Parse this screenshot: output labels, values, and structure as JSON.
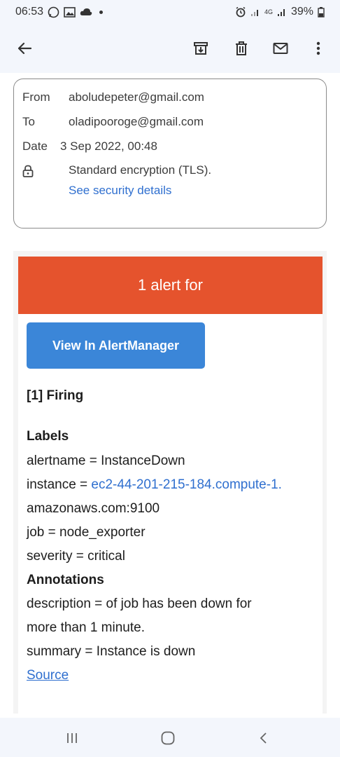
{
  "status_bar": {
    "time": "06:53",
    "battery": "39%",
    "network": "4G"
  },
  "app_bar": {
    "icons": [
      "back-arrow-icon",
      "archive-icon",
      "delete-icon",
      "mark-unread-icon",
      "more-vert-icon"
    ]
  },
  "details": {
    "from_label": "From",
    "from_value": "aboludepeter@gmail.com",
    "to_label": "To",
    "to_value": "oladipooroge@gmail.com",
    "date_label": "Date",
    "date_value": "3 Sep 2022, 00:48",
    "encryption": "Standard encryption (TLS).",
    "security_link": "See security details"
  },
  "mail": {
    "banner": "1 alert for",
    "button": "View In AlertManager",
    "firing": "[1] Firing",
    "labels_heading": "Labels",
    "alertname": "alertname = InstanceDown",
    "instance_prefix": "instance = ",
    "instance_link_1": "ec2-44-201-215-184.compute-1.",
    "instance_link_2": "amazonaws.com:9100",
    "job": "job = node_exporter",
    "severity": "severity = critical",
    "annotations_heading": "Annotations",
    "description_1": "description = of job has been down for",
    "description_2": "more than 1 minute.",
    "summary": "summary = Instance is down",
    "source": "Source"
  },
  "colors": {
    "banner": "#e5532d",
    "button": "#3b86d8",
    "link": "#2f6fcf"
  }
}
